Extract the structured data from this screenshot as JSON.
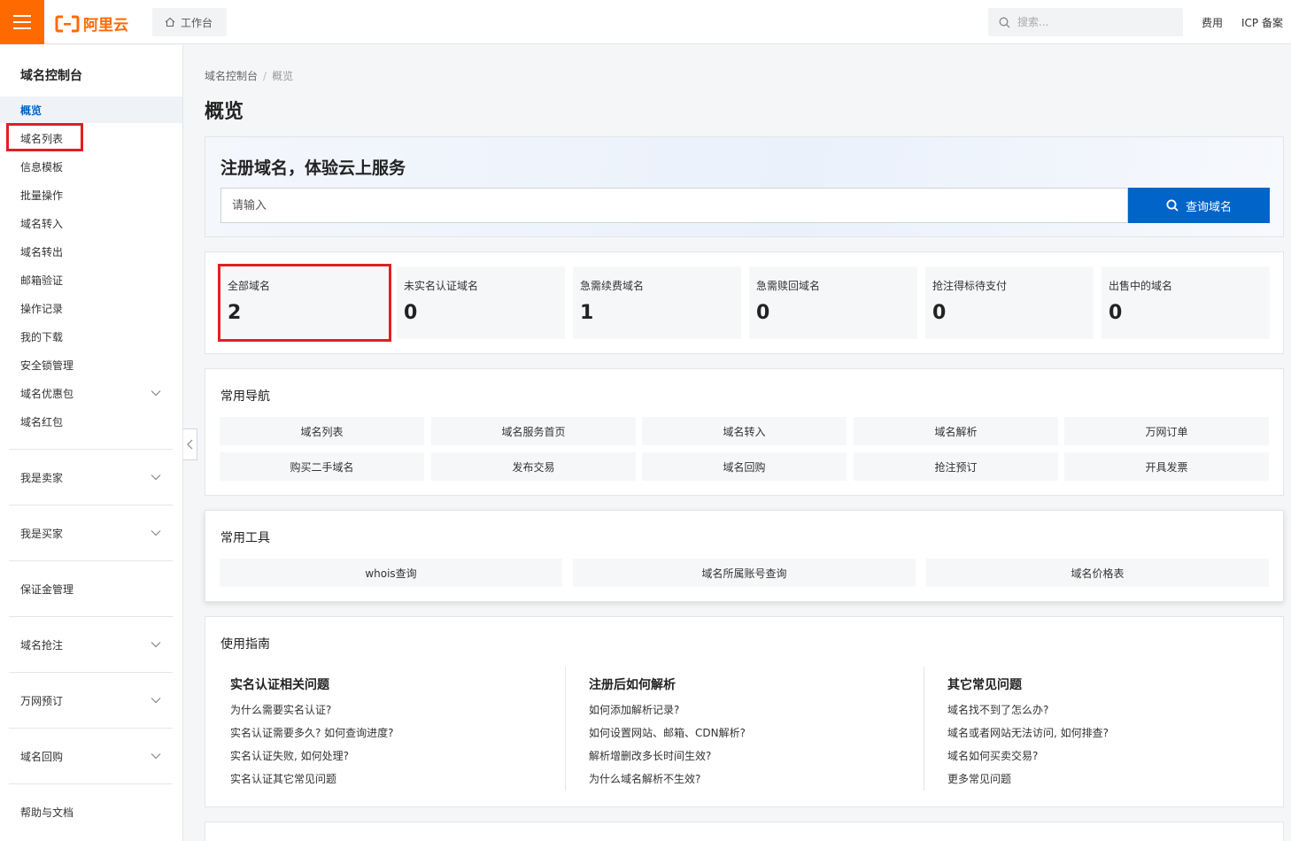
{
  "header": {
    "brand": "阿里云",
    "workbench": "工作台",
    "search_placeholder": "搜索...",
    "links": [
      "费用",
      "ICP 备案"
    ]
  },
  "sidebar": {
    "title": "域名控制台",
    "items": [
      "概览",
      "域名列表",
      "信息模板",
      "批量操作",
      "域名转入",
      "域名转出",
      "邮箱验证",
      "操作记录",
      "我的下载",
      "安全锁管理",
      "域名优惠包",
      "域名红包"
    ],
    "active": "概览",
    "groups": [
      "我是卖家",
      "我是买家",
      "保证金管理",
      "域名抢注",
      "万网预订",
      "域名回购",
      "帮助与文档"
    ]
  },
  "breadcrumb": [
    "域名控制台",
    "概览"
  ],
  "page_title": "概览",
  "hero": {
    "title": "注册域名，体验云上服务",
    "placeholder": "请输入",
    "button": "查询域名"
  },
  "stats": [
    {
      "label": "全部域名",
      "value": "2"
    },
    {
      "label": "未实名认证域名",
      "value": "0"
    },
    {
      "label": "急需续费域名",
      "value": "1"
    },
    {
      "label": "急需赎回域名",
      "value": "0"
    },
    {
      "label": "抢注得标待支付",
      "value": "0"
    },
    {
      "label": "出售中的域名",
      "value": "0"
    }
  ],
  "nav": {
    "title": "常用导航",
    "items": [
      "域名列表",
      "域名服务首页",
      "域名转入",
      "域名解析",
      "万网订单",
      "购买二手域名",
      "发布交易",
      "域名回购",
      "抢注预订",
      "开具发票"
    ]
  },
  "tools": {
    "title": "常用工具",
    "items": [
      "whois查询",
      "域名所属账号查询",
      "域名价格表"
    ]
  },
  "guide": {
    "title": "使用指南",
    "columns": [
      {
        "title": "实名认证相关问题",
        "links": [
          "为什么需要实名认证?",
          "实名认证需要多久? 如何查询进度?",
          "实名认证失败, 如何处理?",
          "实名认证其它常见问题"
        ]
      },
      {
        "title": "注册后如何解析",
        "links": [
          "如何添加解析记录?",
          "如何设置网站、邮箱、CDN解析?",
          "解析增删改多长时间生效?",
          "为什么域名解析不生效?"
        ]
      },
      {
        "title": "其它常见问题",
        "links": [
          "域名找不到了怎么办?",
          "域名或者网站无法访问, 如何排查?",
          "域名如何买卖交易?",
          "更多常见问题"
        ]
      }
    ]
  },
  "colors": {
    "brand": "#ff6a00",
    "primary": "#0064c8",
    "highlight": "#e02020"
  }
}
